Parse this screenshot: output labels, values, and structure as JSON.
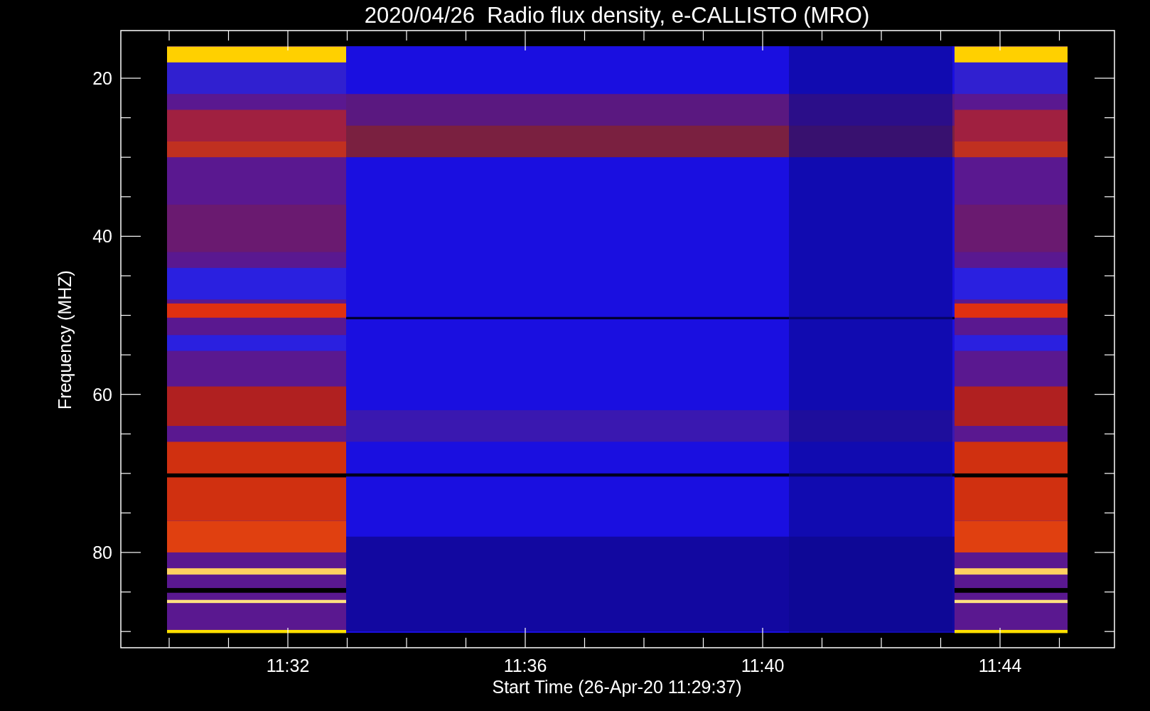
{
  "plot": {
    "title": "2020/04/26  Radio flux density, e-CALLISTO (MRO)",
    "ylabel": "Frequency (MHZ)",
    "yticks": [
      "20",
      "40",
      "60",
      "80"
    ],
    "xticks": [
      "11:32",
      "11:36",
      "11:40",
      "11:44"
    ],
    "xlabel": "Start Time (26-Apr-20 11:29:37)"
  }
}
